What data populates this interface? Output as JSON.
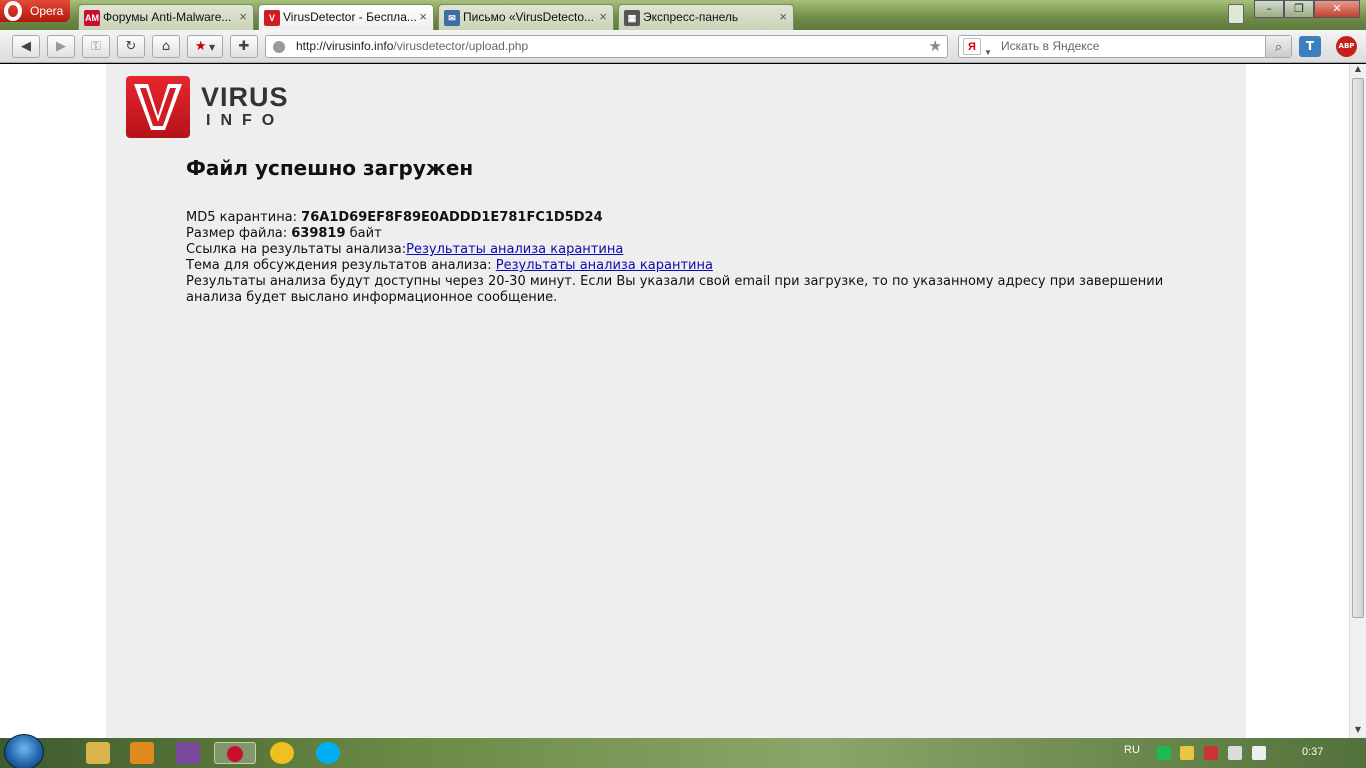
{
  "browser": {
    "menu_label": "Opera",
    "tabs": [
      {
        "label": "Форумы Anti-Malware...",
        "favicon": "AM",
        "close": "×"
      },
      {
        "label": "VirusDetector - Беспла...",
        "favicon": "V",
        "close": "×",
        "active": true
      },
      {
        "label": "Письмо «VirusDetecto...",
        "favicon": "✉",
        "close": "×"
      },
      {
        "label": "Экспресс-панель",
        "favicon": "▦",
        "close": "×"
      }
    ],
    "url_domain": "http://virusinfo.info",
    "url_path": "/virusdetector/upload.php",
    "search_placeholder": "Искать в Яндексе",
    "search_engine_icon": "Я",
    "extension_t": "T",
    "extension_abp": "ABP"
  },
  "page": {
    "logo_word1": "VIRUS",
    "logo_word2": "INFO",
    "title": "Файл успешно загружен",
    "md5_label": "MD5 карантина: ",
    "md5_value": "76A1D69EF8F89E0ADDD1E781FC1D5D24",
    "size_label": "Размер файла: ",
    "size_value": "639819",
    "size_unit": " байт",
    "results_label": "Ссылка на результаты анализа:",
    "results_link": "Результаты анализа карантина",
    "topic_label": "Тема для обсуждения результатов анализа: ",
    "topic_link": "Результаты анализа карантина",
    "note": "Результаты анализа будут доступны через 20-30 минут. Если Вы указали свой email при загрузке, то по указанному адресу при завершении анализа будет выслано информационное сообщение."
  },
  "taskbar": {
    "language": "RU",
    "clock": "0:37"
  },
  "colors": {
    "brand_red": "#d01c24",
    "page_bg": "#eeeeee",
    "link": "#0b0bb0"
  }
}
